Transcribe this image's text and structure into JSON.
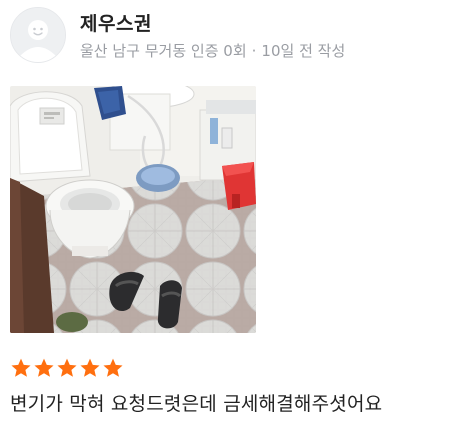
{
  "review": {
    "user": {
      "name": "제우스권",
      "avatar_icon": "default-avatar-icon"
    },
    "meta": {
      "location": "울산 남구 무거동",
      "certification": "인증 0회",
      "separator": "·",
      "time_ago": "10일 전 작성"
    },
    "photo": {
      "subject": "bathroom-toilet-photo"
    },
    "rating": {
      "stars": 5,
      "max_stars": 5,
      "star_color": "#ff6f0f"
    },
    "text": "변기가 막혀 요청드렷은데 금세해결해주셧어요"
  },
  "colors": {
    "name_text": "#222222",
    "meta_text": "#9a9da3",
    "accent": "#ff6f0f"
  }
}
